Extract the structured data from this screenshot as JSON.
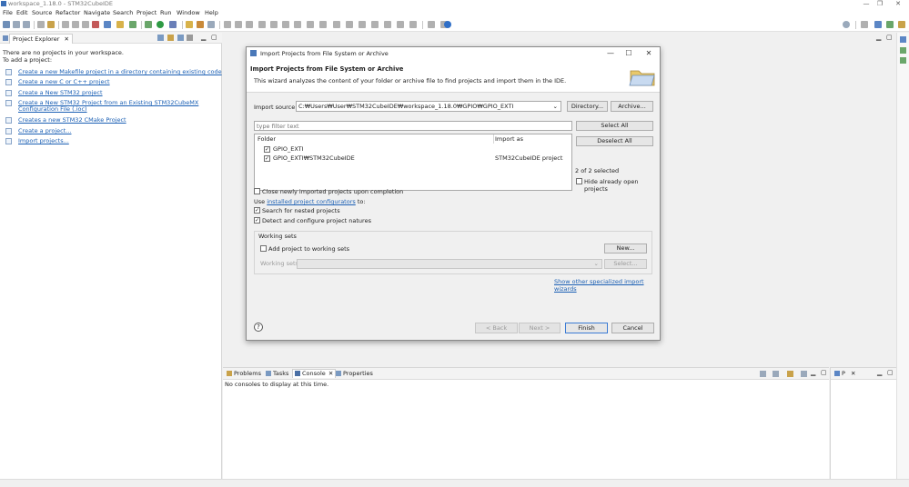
{
  "window": {
    "title": "workspace_1.18.0 - STM32CubeIDE",
    "controls": [
      "—",
      "❐",
      "✕"
    ]
  },
  "menu": [
    "File",
    "Edit",
    "Source",
    "Refactor",
    "Navigate",
    "Search",
    "Project",
    "Run",
    "Window",
    "Help"
  ],
  "explorer": {
    "tab_label": "Project Explorer",
    "empty_line1": "There are no projects in your workspace.",
    "empty_line2": "To add a project:",
    "links": [
      "Create a new Makefile project in a directory containing existing code",
      "Create a new C or C++ project",
      "Create a New STM32 project",
      "Create a New STM32 Project from an Existing STM32CubeMX Configuration File (.ioc)",
      "Creates a new STM32 CMake Project",
      "Create a project...",
      "Import projects..."
    ]
  },
  "dialog": {
    "title": "Import Projects from File System or Archive",
    "header_title": "Import Projects from File System or Archive",
    "header_desc": "This wizard analyzes the content of your folder or archive file to find projects and import them in the IDE.",
    "import_source_label": "Import source:",
    "import_source_value": "C:₩Users₩User₩STM32CubeIDE₩workspace_1.18.0₩GPIO₩GPIO_EXTI",
    "directory_button": "Directory...",
    "archive_button": "Archive...",
    "filter_placeholder": "type filter text",
    "select_all": "Select All",
    "deselect_all": "Deselect All",
    "col_folder": "Folder",
    "col_import_as": "Import as",
    "rows": [
      {
        "folder": "GPIO_EXTI",
        "import_as": "",
        "checked": true
      },
      {
        "folder": "GPIO_EXTI₩STM32CubeIDE",
        "import_as": "STM32CubeIDE project",
        "checked": true
      }
    ],
    "selected_count": "2 of 2 selected",
    "hide_open": "Hide already open projects",
    "close_imported": "Close newly imported projects upon completion",
    "use_prefix": "Use",
    "use_link": "installed project configurators",
    "use_suffix": "to:",
    "search_nested": "Search for nested projects",
    "detect_natures": "Detect and configure project natures",
    "working_sets_group": "Working sets",
    "add_to_working_sets": "Add project to working sets",
    "working_sets_label": "Working sets:",
    "new_button": "New...",
    "select_button": "Select...",
    "show_wizards": "Show other specialized import wizards",
    "back_button": "< Back",
    "next_button": "Next >",
    "finish_button": "Finish",
    "cancel_button": "Cancel",
    "help_glyph": "?"
  },
  "console": {
    "tabs": [
      "Problems",
      "Tasks",
      "Console",
      "Properties"
    ],
    "message": "No consoles to display at this time."
  },
  "outline": {
    "tab": "P"
  },
  "colors": {
    "link": "#1a5fb4",
    "accent": "#3b7bd4"
  }
}
